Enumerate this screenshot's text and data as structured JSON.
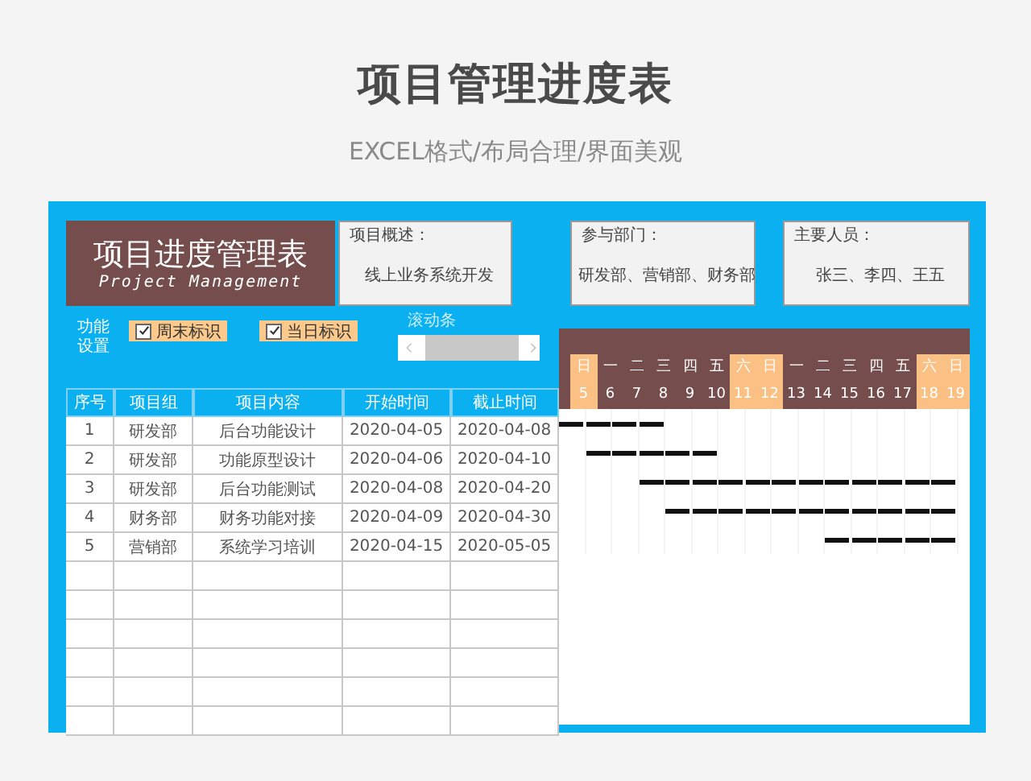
{
  "heading": {
    "title": "项目管理进度表",
    "subtitle": "EXCEL格式/布局合理/界面美观"
  },
  "title_card": {
    "title": "项目进度管理表",
    "subtitle": "Project Management"
  },
  "info_cards": [
    {
      "label": "项目概述：",
      "value": "线上业务系统开发"
    },
    {
      "label": "参与部门：",
      "value": "研发部、营销部、财务部"
    },
    {
      "label": "主要人员：",
      "value": "张三、李四、王五"
    }
  ],
  "settings": {
    "label": "功能设置",
    "checkboxes": [
      {
        "label": "周末标识",
        "checked": true
      },
      {
        "label": "当日标识",
        "checked": true
      }
    ],
    "scrollbar_label": "滚动条"
  },
  "table": {
    "columns": [
      "序号",
      "项目组",
      "项目内容",
      "开始时间",
      "截止时间"
    ],
    "rows": [
      {
        "cells": [
          "1",
          "研发部",
          "后台功能设计",
          "2020-04-05",
          "2020-04-08"
        ],
        "gantt": [
          true,
          true,
          true,
          true,
          false,
          false,
          false,
          false,
          false,
          false,
          false,
          false,
          false,
          false,
          false
        ]
      },
      {
        "cells": [
          "2",
          "研发部",
          "功能原型设计",
          "2020-04-06",
          "2020-04-10"
        ],
        "gantt": [
          false,
          true,
          true,
          true,
          true,
          true,
          false,
          false,
          false,
          false,
          false,
          false,
          false,
          false,
          false
        ]
      },
      {
        "cells": [
          "3",
          "研发部",
          "后台功能测试",
          "2020-04-08",
          "2020-04-20"
        ],
        "gantt": [
          false,
          false,
          false,
          true,
          true,
          true,
          true,
          true,
          true,
          true,
          true,
          true,
          true,
          true,
          true
        ]
      },
      {
        "cells": [
          "4",
          "财务部",
          "财务功能对接",
          "2020-04-09",
          "2020-04-30"
        ],
        "gantt": [
          false,
          false,
          false,
          false,
          true,
          true,
          true,
          true,
          true,
          true,
          true,
          true,
          true,
          true,
          true
        ]
      },
      {
        "cells": [
          "5",
          "营销部",
          "系统学习培训",
          "2020-04-15",
          "2020-05-05"
        ],
        "gantt": [
          false,
          false,
          false,
          false,
          false,
          false,
          false,
          false,
          false,
          false,
          true,
          true,
          true,
          true,
          true
        ]
      }
    ]
  },
  "gantt_days": [
    {
      "weekday": "日",
      "date": "5",
      "weekend": true
    },
    {
      "weekday": "一",
      "date": "6",
      "weekend": false
    },
    {
      "weekday": "二",
      "date": "7",
      "weekend": false
    },
    {
      "weekday": "三",
      "date": "8",
      "weekend": false
    },
    {
      "weekday": "四",
      "date": "9",
      "weekend": false
    },
    {
      "weekday": "五",
      "date": "10",
      "weekend": false
    },
    {
      "weekday": "六",
      "date": "11",
      "weekend": true
    },
    {
      "weekday": "日",
      "date": "12",
      "weekend": true
    },
    {
      "weekday": "一",
      "date": "13",
      "weekend": false
    },
    {
      "weekday": "二",
      "date": "14",
      "weekend": false
    },
    {
      "weekday": "三",
      "date": "15",
      "weekend": false
    },
    {
      "weekday": "四",
      "date": "16",
      "weekend": false
    },
    {
      "weekday": "五",
      "date": "17",
      "weekend": false
    },
    {
      "weekday": "六",
      "date": "18",
      "weekend": true
    },
    {
      "weekday": "日",
      "date": "19",
      "weekend": true
    }
  ]
}
